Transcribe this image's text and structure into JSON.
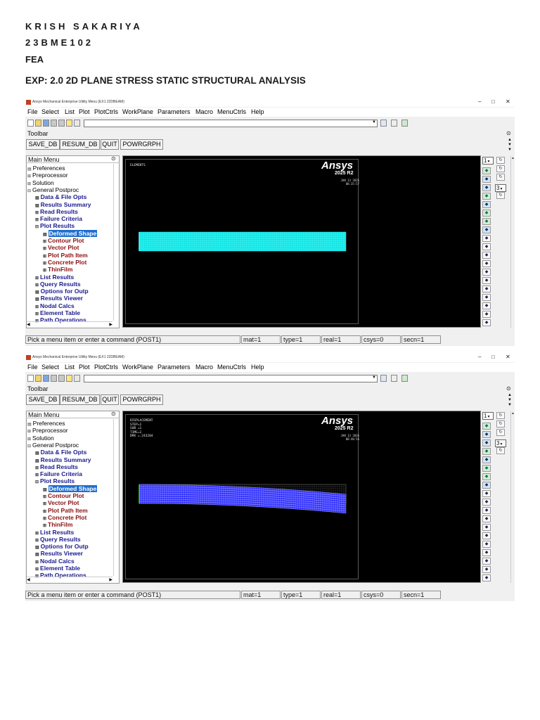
{
  "document": {
    "name": "KRISH SAKARIYA",
    "id": "23BME102",
    "course": "FEA",
    "experiment": "EXP: 2.0 2D PLANE STRESS STATIC STRUCTURAL ANALYSIS"
  },
  "windows": [
    {
      "title": "Ansys Mechanical Enterprise Utility Menu (EX1 22DBEAM)",
      "menu": [
        "File",
        "Select",
        "List",
        "Plot",
        "PlotCtrls",
        "WorkPlane",
        "Parameters",
        "Macro",
        "MenuCtrls",
        "Help"
      ],
      "toolbar_label": "Toolbar",
      "toolbar_buttons": [
        "SAVE_DB",
        "RESUM_DB",
        "QUIT",
        "POWRGRPH"
      ],
      "main_menu_title": "Main Menu",
      "main_menu_items": [
        {
          "label": "Preferences",
          "level": 0,
          "icon": "menu-box-icon"
        },
        {
          "label": "Preprocessor",
          "level": 0,
          "icon": "expand-icon"
        },
        {
          "label": "Solution",
          "level": 0,
          "icon": "expand-icon"
        },
        {
          "label": "General Postproc",
          "level": 0,
          "icon": "collapse-icon"
        },
        {
          "label": "Data & File Opts",
          "level": 1,
          "icon": "menu-box-icon"
        },
        {
          "label": "Results Summary",
          "level": 1,
          "icon": "menu-box-icon"
        },
        {
          "label": "Read Results",
          "level": 1,
          "icon": "expand-icon"
        },
        {
          "label": "Failure Criteria",
          "level": 1,
          "icon": "expand-icon"
        },
        {
          "label": "Plot Results",
          "level": 1,
          "icon": "collapse-icon"
        },
        {
          "label": "Deformed Shape",
          "level": 2,
          "icon": "menu-box-icon",
          "selected": true
        },
        {
          "label": "Contour Plot",
          "level": 2,
          "icon": "expand-icon"
        },
        {
          "label": "Vector Plot",
          "level": 2,
          "icon": "expand-icon"
        },
        {
          "label": "Plot Path Item",
          "level": 2,
          "icon": "expand-icon"
        },
        {
          "label": "Concrete Plot",
          "level": 2,
          "icon": "expand-icon"
        },
        {
          "label": "ThinFilm",
          "level": 2,
          "icon": "expand-icon"
        },
        {
          "label": "List Results",
          "level": 1,
          "icon": "expand-icon"
        },
        {
          "label": "Query Results",
          "level": 1,
          "icon": "expand-icon"
        },
        {
          "label": "Options for Outp",
          "level": 1,
          "icon": "menu-box-icon"
        },
        {
          "label": "Results Viewer",
          "level": 1,
          "icon": "menu-box-icon"
        },
        {
          "label": "Nodal Calcs",
          "level": 1,
          "icon": "expand-icon"
        },
        {
          "label": "Element Table",
          "level": 1,
          "icon": "expand-icon"
        },
        {
          "label": "Path Operations",
          "level": 1,
          "icon": "expand-icon"
        }
      ],
      "graphics": {
        "label_lines": [
          "ELEMENTS"
        ],
        "brand": "Ansys",
        "release": "2025 R2",
        "date_lines": [
          "JAN 13 2026",
          "08:35:57"
        ],
        "mesh_color": "#00e5e5",
        "mesh_line_color": "#7ff7f7",
        "plot": "elements"
      },
      "view_dropdown": "1",
      "zoom_dropdown": "3",
      "status": {
        "prompt": "Pick a menu item or enter a command (POST1)",
        "mat": "mat=1",
        "type": "type=1",
        "real": "real=1",
        "csys": "csys=0",
        "secn": "secn=1"
      }
    },
    {
      "title": "Ansys Mechanical Enterprise Utility Menu (EX1 22DBEAM)",
      "menu": [
        "File",
        "Select",
        "List",
        "Plot",
        "PlotCtrls",
        "WorkPlane",
        "Parameters",
        "Macro",
        "MenuCtrls",
        "Help"
      ],
      "toolbar_label": "Toolbar",
      "toolbar_buttons": [
        "SAVE_DB",
        "RESUM_DB",
        "QUIT",
        "POWRGRPH"
      ],
      "main_menu_title": "Main Menu",
      "main_menu_items": [
        {
          "label": "Preferences",
          "level": 0,
          "icon": "menu-box-icon"
        },
        {
          "label": "Preprocessor",
          "level": 0,
          "icon": "expand-icon"
        },
        {
          "label": "Solution",
          "level": 0,
          "icon": "expand-icon"
        },
        {
          "label": "General Postproc",
          "level": 0,
          "icon": "collapse-icon"
        },
        {
          "label": "Data & File Opts",
          "level": 1,
          "icon": "menu-box-icon"
        },
        {
          "label": "Results Summary",
          "level": 1,
          "icon": "menu-box-icon"
        },
        {
          "label": "Read Results",
          "level": 1,
          "icon": "expand-icon"
        },
        {
          "label": "Failure Criteria",
          "level": 1,
          "icon": "expand-icon"
        },
        {
          "label": "Plot Results",
          "level": 1,
          "icon": "collapse-icon"
        },
        {
          "label": "Deformed Shape",
          "level": 2,
          "icon": "menu-box-icon",
          "selected": true
        },
        {
          "label": "Contour Plot",
          "level": 2,
          "icon": "expand-icon"
        },
        {
          "label": "Vector Plot",
          "level": 2,
          "icon": "expand-icon"
        },
        {
          "label": "Plot Path Item",
          "level": 2,
          "icon": "expand-icon"
        },
        {
          "label": "Concrete Plot",
          "level": 2,
          "icon": "expand-icon"
        },
        {
          "label": "ThinFilm",
          "level": 2,
          "icon": "expand-icon"
        },
        {
          "label": "List Results",
          "level": 1,
          "icon": "expand-icon"
        },
        {
          "label": "Query Results",
          "level": 1,
          "icon": "expand-icon"
        },
        {
          "label": "Options for Outp",
          "level": 1,
          "icon": "menu-box-icon"
        },
        {
          "label": "Results Viewer",
          "level": 1,
          "icon": "menu-box-icon"
        },
        {
          "label": "Nodal Calcs",
          "level": 1,
          "icon": "expand-icon"
        },
        {
          "label": "Element Table",
          "level": 1,
          "icon": "expand-icon"
        },
        {
          "label": "Path Operations",
          "level": 1,
          "icon": "expand-icon"
        }
      ],
      "graphics": {
        "label_lines": [
          "DISPLACEMENT",
          "",
          "STEP=1",
          "SUB =1",
          "TIME=1",
          "DMX =.243284"
        ],
        "brand": "Ansys",
        "release": "2025 R2",
        "date_lines": [
          "JAN 13 2026",
          "08:40:56"
        ],
        "mesh_color": "#2b2bff",
        "mesh_line_color": "#b8b8ff",
        "plot": "deformed"
      },
      "view_dropdown": "1",
      "zoom_dropdown": "3",
      "status": {
        "prompt": "Pick a menu item or enter a command (POST1)",
        "mat": "mat=1",
        "type": "type=1",
        "real": "real=1",
        "csys": "csys=0",
        "secn": "secn=1"
      }
    }
  ]
}
